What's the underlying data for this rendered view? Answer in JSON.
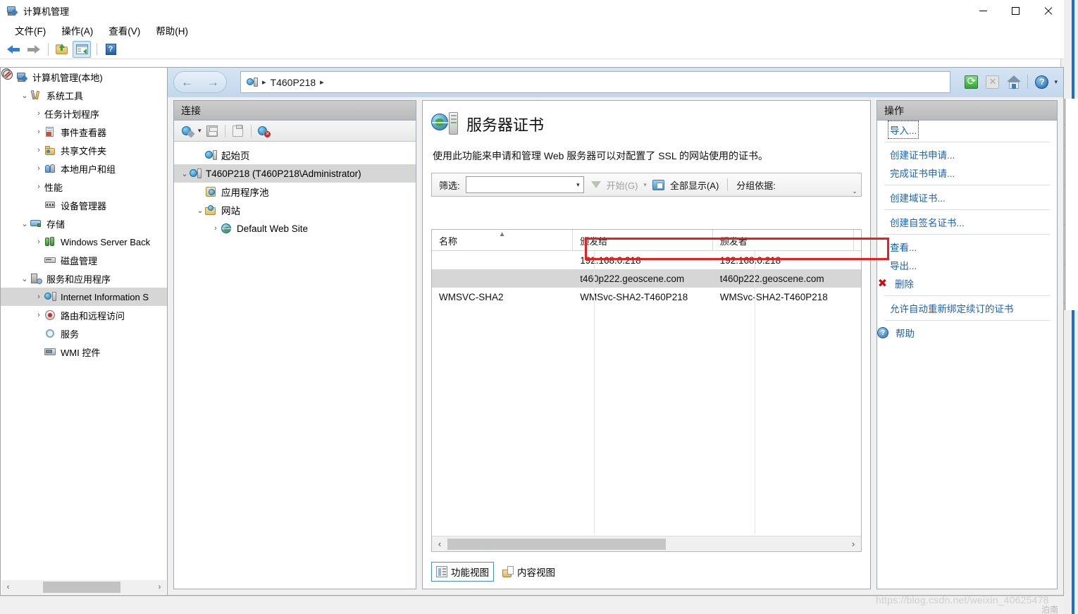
{
  "window": {
    "title": "计算机管理",
    "title_icon": "computer-management-icon",
    "minimize": "—",
    "maximize": "□",
    "close": "✕"
  },
  "menu": {
    "items": [
      {
        "label": "文件(F)",
        "name": "menu-file"
      },
      {
        "label": "操作(A)",
        "name": "menu-action"
      },
      {
        "label": "查看(V)",
        "name": "menu-view"
      },
      {
        "label": "帮助(H)",
        "name": "menu-help"
      }
    ]
  },
  "toolbar": {
    "back": "back-arrow-icon",
    "forward": "forward-arrow-icon",
    "up": "folder-up-icon",
    "show_pane": "show-hide-console-tree-icon",
    "help": "help-icon"
  },
  "tree": {
    "items": [
      {
        "label": "计算机管理(本地)",
        "indent": 0,
        "expander": "",
        "icon": "ic-comp",
        "selected": false
      },
      {
        "label": "系统工具",
        "indent": 1,
        "expander": "v",
        "icon": "ic-tools",
        "selected": false
      },
      {
        "label": "任务计划程序",
        "indent": 2,
        "expander": ">",
        "icon": "ic-clock",
        "selected": false
      },
      {
        "label": "事件查看器",
        "indent": 2,
        "expander": ">",
        "icon": "ic-event",
        "selected": false
      },
      {
        "label": "共享文件夹",
        "indent": 2,
        "expander": ">",
        "icon": "ic-share",
        "selected": false
      },
      {
        "label": "本地用户和组",
        "indent": 2,
        "expander": ">",
        "icon": "ic-users",
        "selected": false
      },
      {
        "label": "性能",
        "indent": 2,
        "expander": ">",
        "icon": "ic-perf",
        "selected": false
      },
      {
        "label": "设备管理器",
        "indent": 2,
        "expander": "",
        "icon": "ic-devm",
        "selected": false
      },
      {
        "label": "存储",
        "indent": 1,
        "expander": "v",
        "icon": "ic-store",
        "selected": false
      },
      {
        "label": "Windows Server Back",
        "indent": 2,
        "expander": ">",
        "icon": "ic-wsb",
        "selected": false
      },
      {
        "label": "磁盘管理",
        "indent": 2,
        "expander": "",
        "icon": "ic-disk",
        "selected": false
      },
      {
        "label": "服务和应用程序",
        "indent": 1,
        "expander": "v",
        "icon": "ic-svcapp",
        "selected": false
      },
      {
        "label": "Internet Information S",
        "indent": 2,
        "expander": ">",
        "icon": "ic-iis",
        "selected": true
      },
      {
        "label": "路由和远程访问",
        "indent": 2,
        "expander": ">",
        "icon": "ic-ras",
        "selected": false
      },
      {
        "label": "服务",
        "indent": 2,
        "expander": "",
        "icon": "ic-svc",
        "selected": false
      },
      {
        "label": "WMI 控件",
        "indent": 2,
        "expander": "",
        "icon": "ic-wmi",
        "selected": false
      }
    ],
    "scroll_left": "‹",
    "scroll_right": "›"
  },
  "address": {
    "back": "←",
    "forward": "→",
    "server_icon": "server-icon",
    "crumb": "T460P218",
    "sep": "▸",
    "refresh_icon": "refresh-icon",
    "stop_icon": "stop-icon",
    "home_icon": "home-icon",
    "help_icon": "help-icon",
    "caret": "▾"
  },
  "connections": {
    "title": "连接",
    "toolbar": {
      "connect": "connect-to-icon",
      "connect_caret": "▾",
      "save": "save-icon",
      "clipboard": "clipboard-icon",
      "disconnect": "disconnect-icon"
    },
    "nodes": [
      {
        "label": "起始页",
        "indent": 1,
        "expander": "",
        "icon": "ci-srv",
        "selected": false
      },
      {
        "label": "T460P218 (T460P218\\Administrator)",
        "indent": 0,
        "expander": "v",
        "icon": "ci-srv",
        "selected": true
      },
      {
        "label": "应用程序池",
        "indent": 1,
        "expander": "",
        "icon": "ci-pool",
        "selected": false
      },
      {
        "label": "网站",
        "indent": 1,
        "expander": "v",
        "icon": "ci-sites",
        "selected": false
      },
      {
        "label": "Default Web Site",
        "indent": 2,
        "expander": ">",
        "icon": "ci-web",
        "selected": false
      }
    ]
  },
  "feature": {
    "icon": "server-certificates-icon",
    "title": "服务器证书",
    "description": "使用此功能来申请和管理 Web 服务器可以对配置了 SSL 的网站使用的证书。"
  },
  "filter_bar": {
    "filter_label": "筛选:",
    "filter_value": "",
    "combo_caret": "▾",
    "go_label": "开始(G)",
    "go_caret": "▾",
    "show_all_label": "全部显示(A)",
    "group_by_label": "分组依据:",
    "expander": "⌄"
  },
  "table": {
    "columns": [
      {
        "label": "名称",
        "sort": "^"
      },
      {
        "label": "颁发给",
        "sort": ""
      },
      {
        "label": "颁发者",
        "sort": ""
      },
      {
        "label": "",
        "sort": ""
      }
    ],
    "rows": [
      {
        "name": "",
        "issued_to": "192.168.0.218",
        "issued_by": "192.168.0.218",
        "extra": "",
        "selected": false
      },
      {
        "name": "",
        "issued_to": "t460p222.geoscene.com",
        "issued_by": "t460p222.geoscene.com",
        "extra": "",
        "selected": true
      },
      {
        "name": "WMSVC-SHA2",
        "issued_to": "WMSvc-SHA2-T460P218",
        "issued_by": "WMSvc-SHA2-T460P218",
        "extra": "",
        "selected": false
      }
    ],
    "scroll_left": "‹",
    "scroll_right": "›"
  },
  "view_tabs": [
    {
      "label": "功能视图",
      "icon": "features-view-icon",
      "active": true
    },
    {
      "label": "内容视图",
      "icon": "content-view-icon",
      "active": false
    }
  ],
  "actions": {
    "title": "操作",
    "items": [
      {
        "label": "导入...",
        "icon": "",
        "focused": true,
        "sep_after": true
      },
      {
        "label": "创建证书申请...",
        "icon": "",
        "focused": false,
        "sep_after": false
      },
      {
        "label": "完成证书申请...",
        "icon": "",
        "focused": false,
        "sep_after": true
      },
      {
        "label": "创建域证书...",
        "icon": "",
        "focused": false,
        "sep_after": true
      },
      {
        "label": "创建自签名证书...",
        "icon": "",
        "focused": false,
        "sep_after": true
      },
      {
        "label": "查看...",
        "icon": "",
        "focused": false,
        "sep_after": false
      },
      {
        "label": "导出...",
        "icon": "",
        "focused": false,
        "sep_after": false
      },
      {
        "label": "删除",
        "icon": "delete-x-icon",
        "focused": false,
        "sep_after": true
      },
      {
        "label": "允许自动重新绑定续订的证书",
        "icon": "",
        "focused": false,
        "sep_after": true
      },
      {
        "label": "帮助",
        "icon": "help-circle-icon",
        "focused": false,
        "sep_after": false
      }
    ]
  },
  "watermark": {
    "url": "https://blog.csdn.net/weixin_40625478",
    "extra": "泊南"
  },
  "colors": {
    "accent": "#1a62b8",
    "annotation_red": "#ee1c1c",
    "selection_gray": "#d6d6d6",
    "chrome_blue": "#c2d7ec"
  }
}
